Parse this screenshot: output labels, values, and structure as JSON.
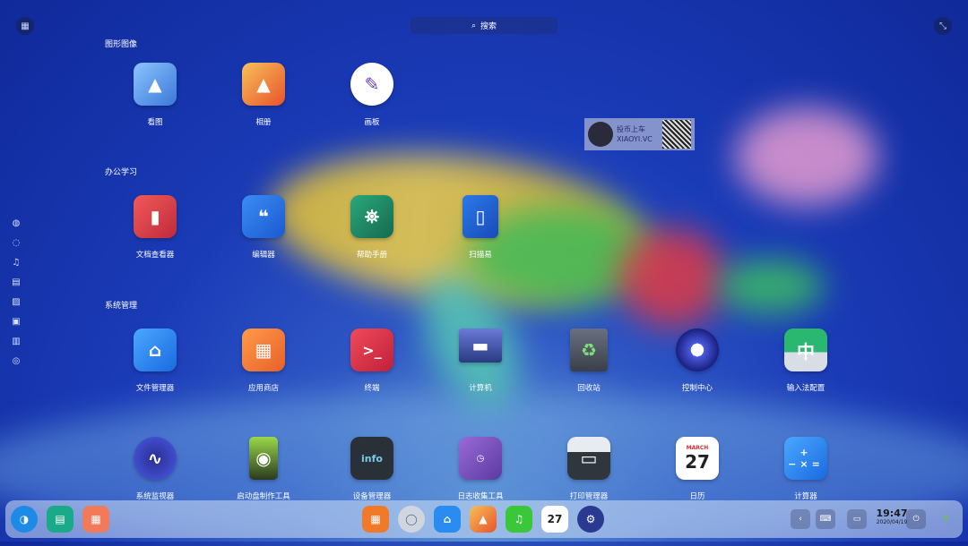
{
  "search": {
    "label": "搜索"
  },
  "categories": {
    "graphics": "图形图像",
    "office": "办公学习",
    "system": "系统管理"
  },
  "apps": {
    "graphics": [
      {
        "name": "看图",
        "icon": "image-viewer-icon",
        "color": "#4a8fe0"
      },
      {
        "name": "相册",
        "icon": "album-icon",
        "color": "#f08a3c"
      },
      {
        "name": "画板",
        "icon": "drawing-board-icon",
        "color": "#ffffff"
      }
    ],
    "office": [
      {
        "name": "文档查看器",
        "icon": "document-viewer-icon",
        "color": "#e04848"
      },
      {
        "name": "编辑器",
        "icon": "text-editor-icon",
        "color": "#1e6fe0"
      },
      {
        "name": "帮助手册",
        "icon": "help-manual-icon",
        "color": "#1e8a6a"
      },
      {
        "name": "扫描易",
        "icon": "scanner-icon",
        "color": "#1e5ec8"
      }
    ],
    "system": [
      {
        "name": "文件管理器",
        "icon": "file-manager-icon",
        "color": "#2a8cf0"
      },
      {
        "name": "应用商店",
        "icon": "app-store-icon",
        "color": "#f07a2a"
      },
      {
        "name": "终端",
        "icon": "terminal-icon",
        "color": "#d83040"
      },
      {
        "name": "计算机",
        "icon": "computer-icon",
        "color": "#3a4a80"
      },
      {
        "name": "回收站",
        "icon": "trash-icon",
        "color": "#5a6070"
      },
      {
        "name": "控制中心",
        "icon": "control-center-icon",
        "color": "#2a3a90"
      },
      {
        "name": "输入法配置",
        "icon": "input-method-icon",
        "color": "#2aa060"
      }
    ],
    "row4": [
      {
        "name": "系统监视器",
        "icon": "system-monitor-icon",
        "color": "#3a3fa0"
      },
      {
        "name": "启动盘制作工具",
        "icon": "boot-maker-icon",
        "color": "#3a7a30"
      },
      {
        "name": "设备管理器",
        "icon": "device-manager-icon",
        "color": "#2a3038"
      },
      {
        "name": "日志收集工具",
        "icon": "log-viewer-icon",
        "color": "#7a4ab0"
      },
      {
        "name": "打印管理器",
        "icon": "print-manager-icon",
        "color": "#30363d"
      },
      {
        "name": "日历",
        "icon": "calendar-icon",
        "color": "#ffffff"
      },
      {
        "name": "计算器",
        "icon": "calculator-icon",
        "color": "#2a8cf0"
      }
    ]
  },
  "icon_glyphs": {
    "info": "info",
    "calendar_month": "MARCH",
    "calendar_day": "27",
    "input_method_char": "中",
    "terminal_prompt": ">_",
    "calculator_keys": "+−×="
  },
  "watermark": {
    "line1": "投币上车",
    "line2": "XIAOYI.VC"
  },
  "dock": {
    "apps_left": [
      "launcher-icon",
      "multitask-view-icon",
      "workspace-icon"
    ],
    "apps_center": [
      "app-store-icon",
      "browser-icon",
      "file-manager-icon",
      "album-icon",
      "music-icon",
      "calendar-icon",
      "control-center-icon"
    ],
    "calendar_day": "27"
  },
  "clock": {
    "time": "19:47",
    "date": "2020/04/19"
  }
}
